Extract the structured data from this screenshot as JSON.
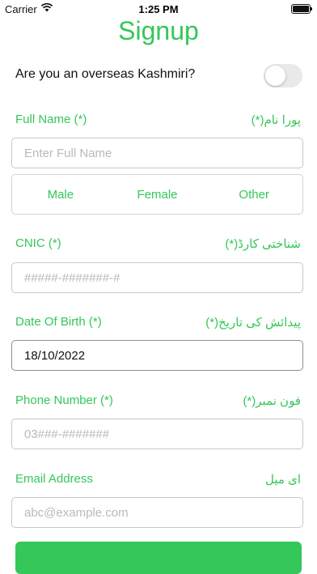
{
  "status_bar": {
    "carrier": "Carrier",
    "time": "1:25 PM"
  },
  "title": "Signup",
  "overseas": {
    "question": "Are you an overseas Kashmiri?",
    "toggle_on": false
  },
  "full_name": {
    "label": "Full Name (*)",
    "label_urdu": "پورا نام(*)",
    "placeholder": "Enter Full Name",
    "value": ""
  },
  "gender": {
    "options": [
      "Male",
      "Female",
      "Other"
    ]
  },
  "cnic": {
    "label": "CNIC (*)",
    "label_urdu": "شناختی کارڈ(*)",
    "placeholder": "#####-#######-#",
    "value": ""
  },
  "dob": {
    "label": "Date Of Birth (*)",
    "label_urdu": "پیدائش کی تاریخ(*)",
    "value": "18/10/2022"
  },
  "phone": {
    "label": "Phone Number (*)",
    "label_urdu": "فون نمبر(*)",
    "placeholder": "03###-#######",
    "value": ""
  },
  "email": {
    "label": "Email Address",
    "label_urdu": "ای میل",
    "placeholder": "abc@example.com",
    "value": ""
  },
  "colors": {
    "accent": "#34c759",
    "border": "#c7c7cc"
  }
}
